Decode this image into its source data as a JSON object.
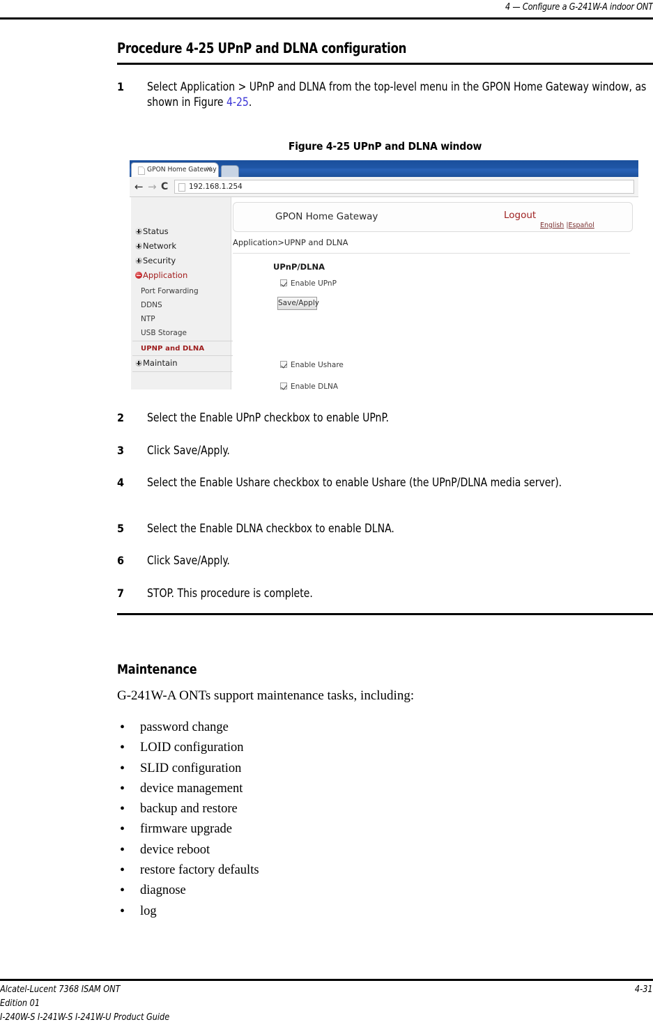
{
  "running_header": "4 —  Configure a G-241W-A indoor ONT",
  "procedure": {
    "title": "Procedure 4-25  UPnP and DLNA configuration",
    "steps": [
      {
        "num": "1",
        "text_before": "Select Application > UPnP and DLNA from the top-level menu in the GPON Home Gateway window, as shown in Figure ",
        "xref": "4-25",
        "text_after": "."
      },
      {
        "num": "2",
        "text_before": "Select the Enable UPnP checkbox to enable UPnP.",
        "xref": "",
        "text_after": ""
      },
      {
        "num": "3",
        "text_before": "Click Save/Apply.",
        "xref": "",
        "text_after": ""
      },
      {
        "num": "4",
        "text_before": "Select the Enable Ushare checkbox to enable Ushare (the UPnP/DLNA media server).",
        "xref": "",
        "text_after": ""
      },
      {
        "num": "5",
        "text_before": "Select the Enable DLNA checkbox to enable DLNA.",
        "xref": "",
        "text_after": ""
      },
      {
        "num": "6",
        "text_before": "Click Save/Apply.",
        "xref": "",
        "text_after": ""
      },
      {
        "num": "7",
        "text_before": "STOP. This procedure is complete.",
        "xref": "",
        "text_after": ""
      }
    ]
  },
  "figure": {
    "caption": "Figure 4-25  UPnP and DLNA window",
    "browser": {
      "tab_title": "GPON Home Gateway",
      "tab_close": "×",
      "back_icon": "←",
      "forward_icon": "→",
      "reload_icon": "C",
      "url": "192.168.1.254"
    },
    "page": {
      "brand": "GPON Home Gateway",
      "logout": "Logout",
      "lang_english": "English",
      "lang_separator": " |",
      "lang_espanol": "Español",
      "breadcrumb": "Application>UPNP and DLNA",
      "section_title": "UPnP/DLNA",
      "sidebar": {
        "top_items": [
          {
            "label": "Status",
            "state": "plus"
          },
          {
            "label": "Network",
            "state": "plus"
          },
          {
            "label": "Security",
            "state": "plus"
          },
          {
            "label": "Application",
            "state": "minus"
          }
        ],
        "sub_items": [
          "Port Forwarding",
          "DDNS",
          "NTP",
          "USB Storage"
        ],
        "current_item": "UPNP and DLNA",
        "last_item": {
          "label": "Maintain",
          "state": "plus"
        }
      },
      "checkboxes": [
        {
          "label": "Enable UPnP",
          "checked": true
        },
        {
          "label": "Enable Ushare",
          "checked": true
        },
        {
          "label": "Enable DLNA",
          "checked": true
        }
      ],
      "buttons": {
        "save_apply": "Save/Apply"
      }
    }
  },
  "maintenance": {
    "heading": "Maintenance",
    "intro": "G-241W-A ONTs support maintenance tasks, including:",
    "bullet_glyph": "•",
    "items": [
      "password change",
      "LOID configuration",
      "SLID configuration",
      "device management",
      "backup and restore",
      "firmware upgrade",
      "device reboot",
      "restore factory defaults",
      "diagnose",
      "log"
    ]
  },
  "footer": {
    "line1": "Alcatel-Lucent 7368 ISAM ONT",
    "line2": "Edition 01",
    "line3": "I-240W-S I-241W-S I-241W-U Product Guide",
    "page_number": "4-31"
  },
  "colors": {
    "xref_blue": "#3b35d6",
    "browser_titlebar": "#1f56a6",
    "menu_active_red": "#a11b1b",
    "logout_red": "#9e2020"
  }
}
